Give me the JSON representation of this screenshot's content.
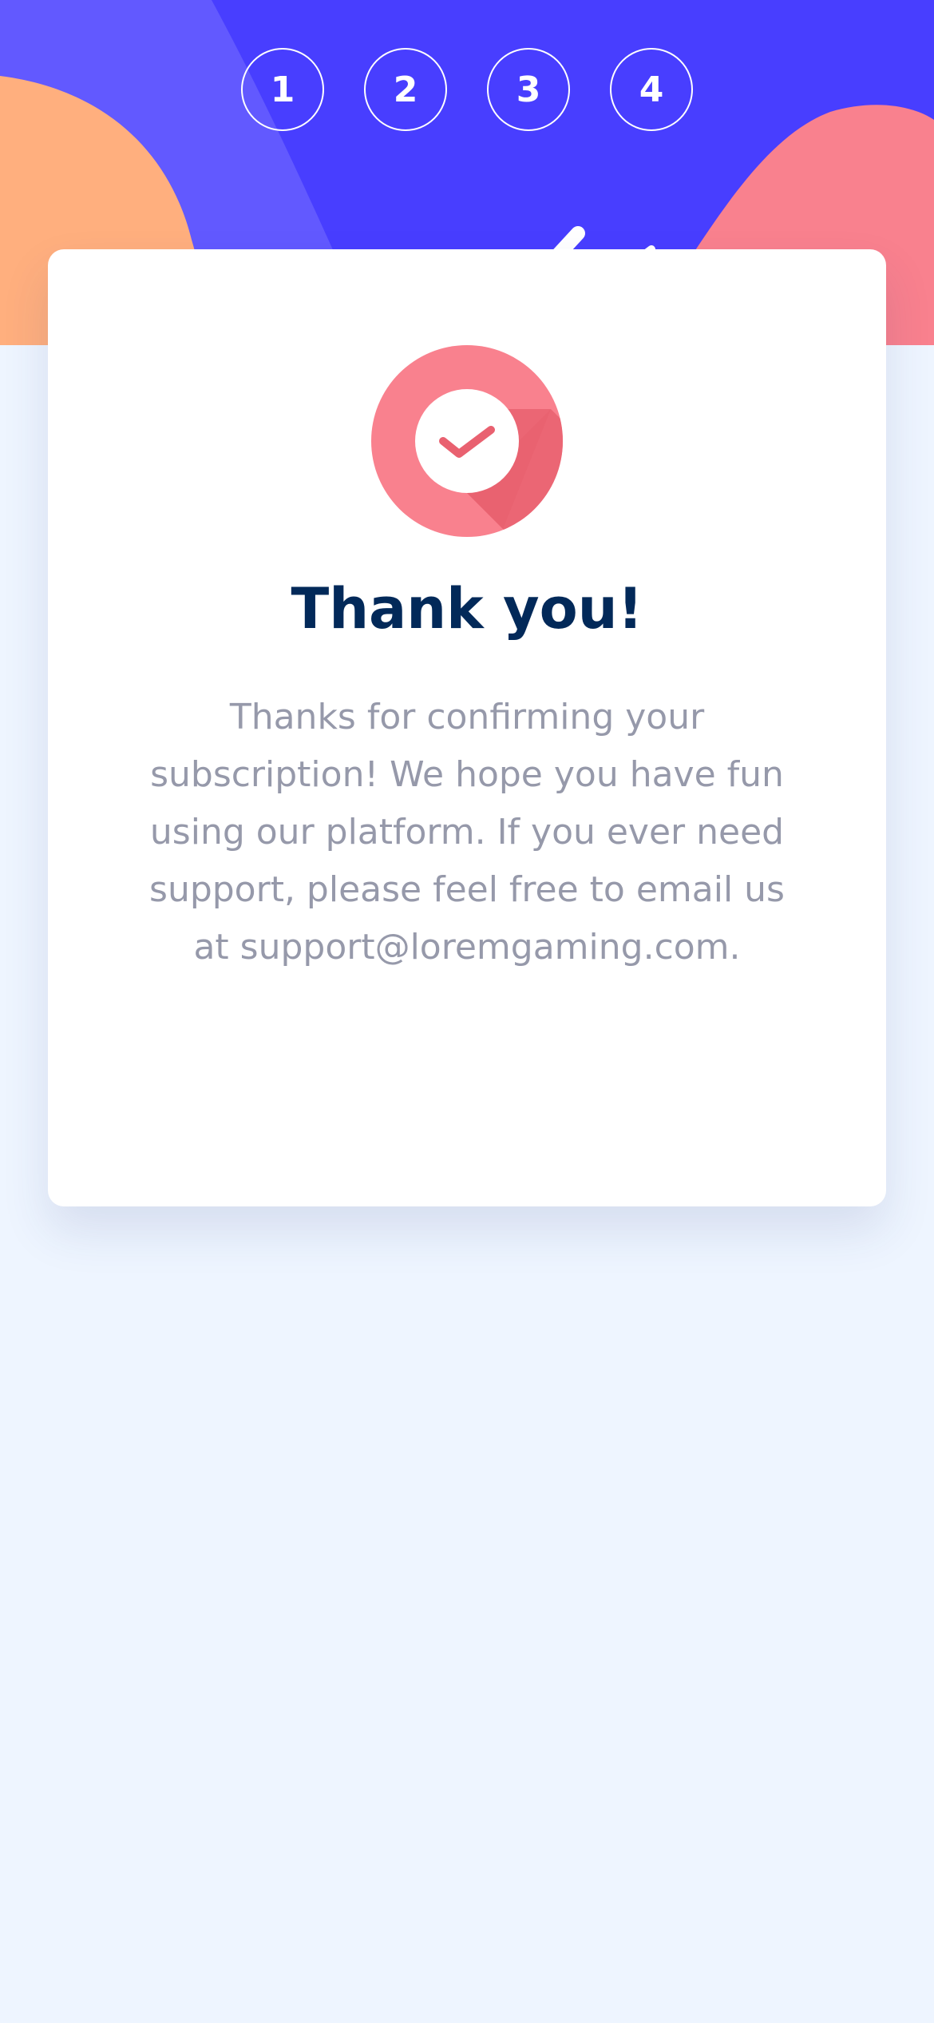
{
  "steps": [
    {
      "number": "1"
    },
    {
      "number": "2"
    },
    {
      "number": "3"
    },
    {
      "number": "4"
    }
  ],
  "confirmation": {
    "icon": "checkmark-icon",
    "title": "Thank you!",
    "message": "Thanks for confirming your subscription! We hope you have fun using our platform. If you ever need support, please feel free to email us at support@loremgaming.com."
  },
  "colors": {
    "header": "#483EFF",
    "header_light": "#6259FF",
    "peach": "#FFAF7E",
    "pink": "#F9818E",
    "title": "#022959",
    "text": "#9699AA",
    "background": "#EEF5FF"
  }
}
